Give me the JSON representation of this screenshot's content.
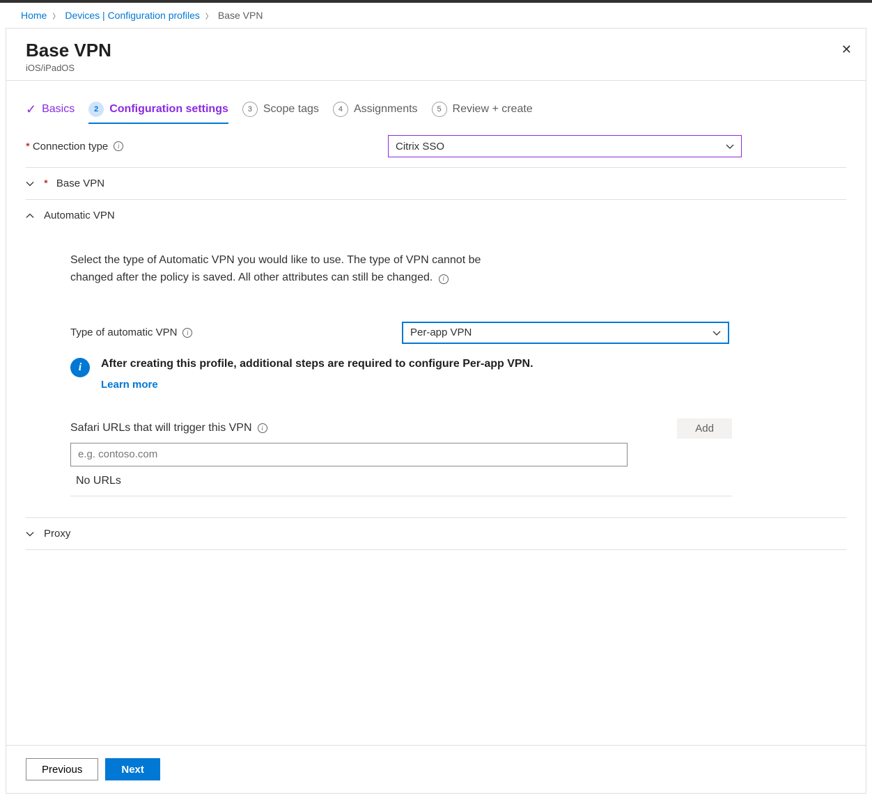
{
  "breadcrumb": {
    "home": "Home",
    "devices": "Devices | Configuration profiles",
    "current": "Base VPN"
  },
  "header": {
    "title": "Base VPN",
    "subtitle": "iOS/iPadOS"
  },
  "wizard": {
    "step1": "Basics",
    "step2_num": "2",
    "step2": "Configuration settings",
    "step3_num": "3",
    "step3": "Scope tags",
    "step4_num": "4",
    "step4": "Assignments",
    "step5_num": "5",
    "step5": "Review + create"
  },
  "form": {
    "connection_type_label": "Connection type",
    "connection_type_value": "Citrix SSO",
    "base_vpn_section": "Base VPN",
    "auto_vpn_section": "Automatic VPN",
    "auto_vpn_desc": "Select the type of Automatic VPN you would like to use. The type of VPN cannot be changed after the policy is saved. All other attributes can still be changed.",
    "auto_vpn_type_label": "Type of automatic VPN",
    "auto_vpn_type_value": "Per-app VPN",
    "info_title": "After creating this profile, additional steps are required to configure Per-app VPN.",
    "info_link": "Learn more",
    "safari_label": "Safari URLs that will trigger this VPN",
    "add_button": "Add",
    "safari_placeholder": "e.g. contoso.com",
    "no_urls": "No URLs",
    "proxy_section": "Proxy"
  },
  "footer": {
    "previous": "Previous",
    "next": "Next"
  }
}
